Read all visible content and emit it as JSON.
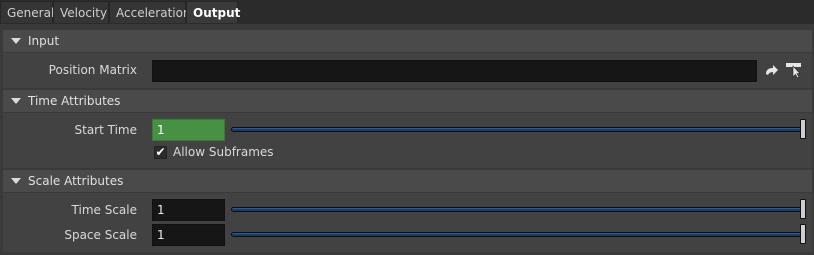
{
  "tabs": [
    {
      "label": "General"
    },
    {
      "label": "Velocity"
    },
    {
      "label": "Acceleration"
    },
    {
      "label": "Output",
      "active": true
    }
  ],
  "sections": {
    "input": {
      "title": "Input",
      "position_matrix": {
        "label": "Position Matrix",
        "value": ""
      }
    },
    "time": {
      "title": "Time Attributes",
      "start_time": {
        "label": "Start Time",
        "value": "1",
        "slider_fraction": 1.0
      },
      "allow_subframes": {
        "label": "Allow Subframes",
        "checked": true
      }
    },
    "scale": {
      "title": "Scale Attributes",
      "time_scale": {
        "label": "Time Scale",
        "value": "1",
        "slider_fraction": 1.0
      },
      "space_scale": {
        "label": "Space Scale",
        "value": "1",
        "slider_fraction": 1.0
      }
    }
  },
  "icons": {
    "jump": "jump-to-operator-icon",
    "select": "select-from-viewport-icon"
  },
  "colors": {
    "active_field": "#469144",
    "slider_fill": "#1b3a66"
  }
}
